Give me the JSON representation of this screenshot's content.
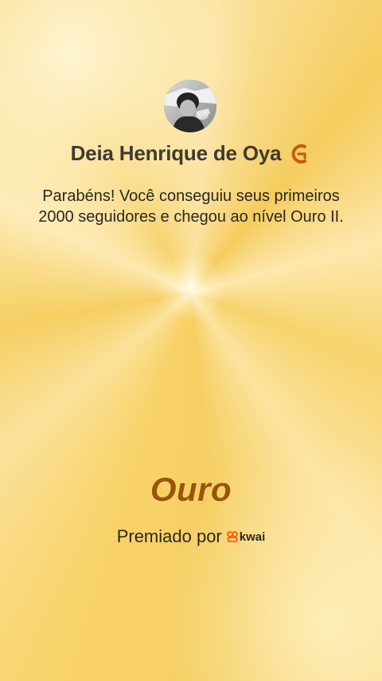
{
  "profile": {
    "name": "Deia Henrique de Oya",
    "badge_icon": "ouro-level-icon"
  },
  "message": "Parabéns! Você conseguiu seus primeiros 2000 seguidores e chegou ao nível Ouro II.",
  "tier": {
    "label": "Ouro"
  },
  "awarded_by": {
    "label": "Premiado por",
    "brand": "kwai"
  },
  "colors": {
    "tier_text": "#9a5408",
    "badge": "#c25b12",
    "background": "#f7d675",
    "kwai_mark": "#ff5a00"
  }
}
